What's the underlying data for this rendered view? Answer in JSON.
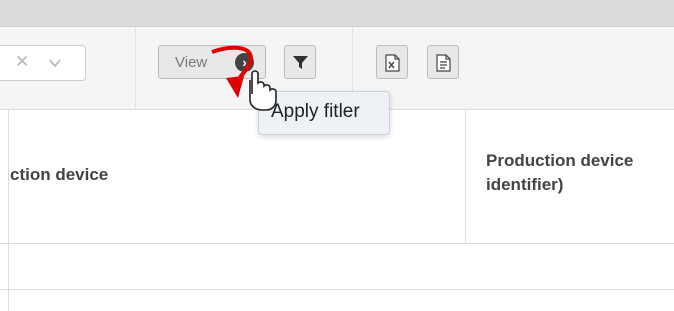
{
  "toolbar": {
    "select_clear_icon": "close-icon",
    "select_chevron_icon": "chevron-down-icon",
    "view_label": "View",
    "view_go_icon": "chevron-right-circle-icon",
    "filter_icon": "funnel-icon",
    "excel_icon": "excel-export-icon",
    "doc_icon": "document-export-icon"
  },
  "tooltip": {
    "text": "Apply fitler"
  },
  "table": {
    "columns": [
      {
        "label": "ction device"
      },
      {
        "label_line1": "Production device",
        "label_line2": "identifier)"
      }
    ]
  },
  "colors": {
    "annotation_arrow": "#e00000",
    "tooltip_bg": "#eef2f7"
  }
}
